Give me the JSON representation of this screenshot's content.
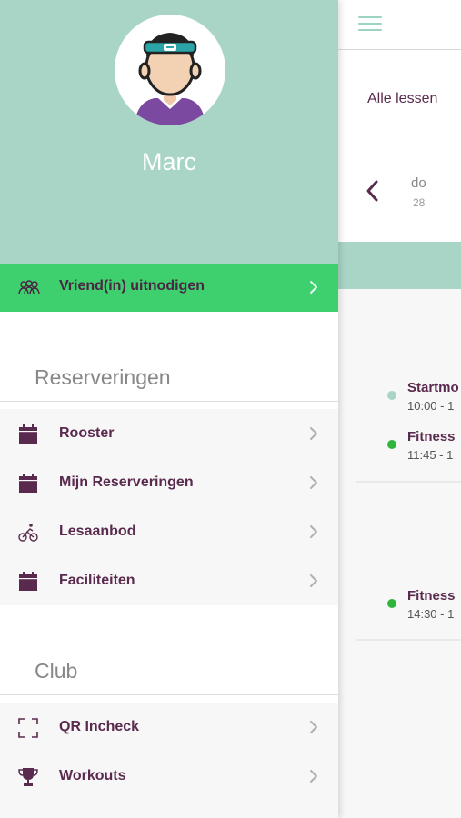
{
  "content": {
    "filter_label": "Alle lessen",
    "date": {
      "day_name": "do",
      "day_number": "28"
    },
    "lessons": [
      {
        "title": "Startmo",
        "time": "10:00 - 1",
        "status_color": "#a8d5c5"
      },
      {
        "title": "Fitness",
        "time": "11:45 - 1",
        "status_color": "#2fb53c"
      },
      {
        "title": "Fitness",
        "time": "14:30 - 1",
        "status_color": "#2fb53c"
      }
    ]
  },
  "drawer": {
    "user_name": "Marc",
    "invite_label": "Vriend(in) uitnodigen",
    "sections": [
      {
        "title": "Reserveringen",
        "items": [
          {
            "label": "Rooster",
            "icon": "calendar-icon"
          },
          {
            "label": "Mijn Reserveringen",
            "icon": "calendar-icon"
          },
          {
            "label": "Lesaanbod",
            "icon": "cyclist-icon"
          },
          {
            "label": "Faciliteiten",
            "icon": "calendar-icon"
          }
        ]
      },
      {
        "title": "Club",
        "items": [
          {
            "label": "QR Incheck",
            "icon": "qr-scan-icon"
          },
          {
            "label": "Workouts",
            "icon": "trophy-icon"
          }
        ]
      }
    ]
  },
  "colors": {
    "header_mint": "#a8d5c5",
    "invite_green": "#3ecf6f",
    "accent_plum": "#5a2a4e",
    "status_green": "#2fb53c"
  }
}
